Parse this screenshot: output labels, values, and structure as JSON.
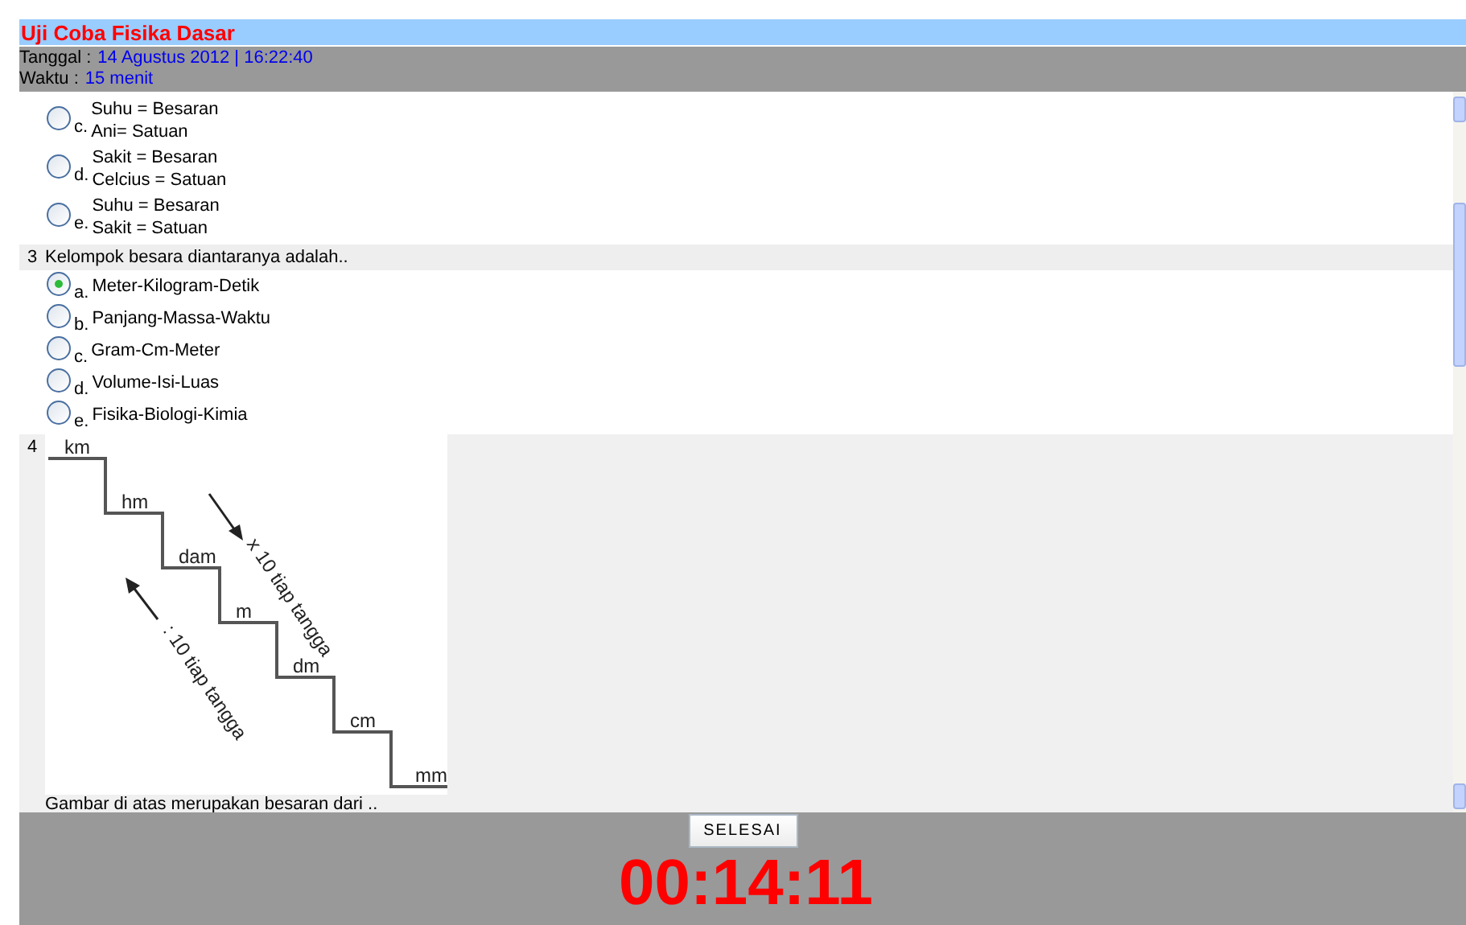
{
  "header": {
    "title": "Uji Coba Fisika Dasar",
    "date_label": "Tanggal :",
    "date_value": "14 Agustus 2012 | 16:22:40",
    "time_label": "Waktu :",
    "time_value": "15 menit"
  },
  "questions": [
    {
      "options": [
        {
          "letter": "c.",
          "text": "Suhu = Besaran\nAni= Satuan",
          "selected": false
        },
        {
          "letter": "d.",
          "text": "Sakit = Besaran\nCelcius = Satuan",
          "selected": false
        },
        {
          "letter": "e.",
          "text": "Suhu = Besaran\nSakit = Satuan",
          "selected": false
        }
      ]
    },
    {
      "number": "3",
      "text": "Kelompok besara diantaranya adalah..",
      "options": [
        {
          "letter": "a.",
          "text": "Meter-Kilogram-Detik",
          "selected": true
        },
        {
          "letter": "b.",
          "text": "Panjang-Massa-Waktu",
          "selected": false
        },
        {
          "letter": "c.",
          "text": "Gram-Cm-Meter",
          "selected": false
        },
        {
          "letter": "d.",
          "text": "Volume-Isi-Luas",
          "selected": false
        },
        {
          "letter": "e.",
          "text": "Fisika-Biologi-Kimia",
          "selected": false
        }
      ]
    },
    {
      "number": "4",
      "figure": {
        "steps": [
          "km",
          "hm",
          "dam",
          "m",
          "dm",
          "cm",
          "mm"
        ],
        "down_note": "x 10 tiap tangga",
        "up_note": ": 10 tiap tangga"
      },
      "text": "Gambar di atas merupakan besaran dari .."
    }
  ],
  "footer": {
    "button": "SELESAI",
    "timer": "00:14:11"
  }
}
